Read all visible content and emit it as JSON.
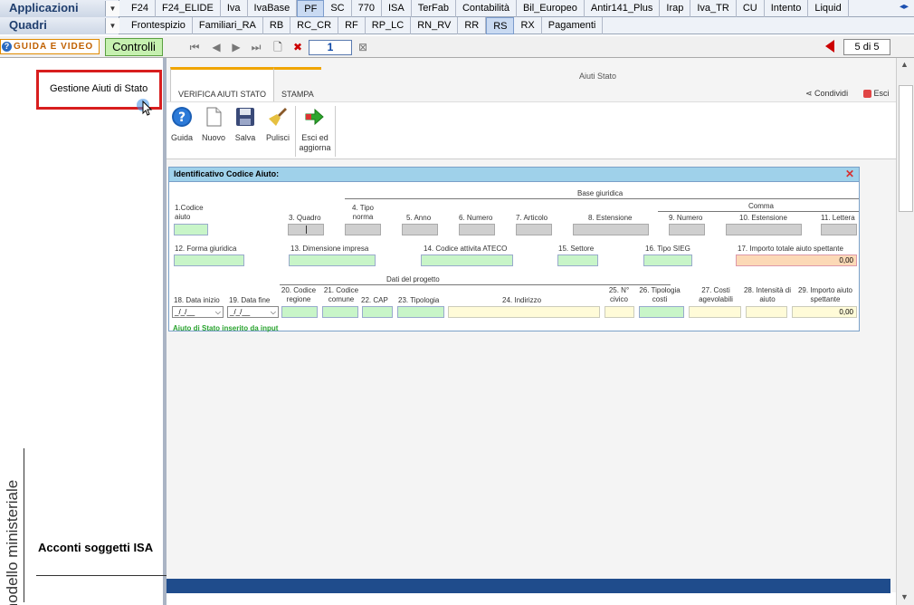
{
  "top_menu": {
    "row1_label": "Applicazioni",
    "row1_items": [
      "F24",
      "F24_ELIDE",
      "Iva",
      "IvaBase",
      "PF",
      "SC",
      "770",
      "ISA",
      "TerFab",
      "Contabilità",
      "Bil_Europeo",
      "Antir141_Plus",
      "Irap",
      "Iva_TR",
      "CU",
      "Intento",
      "Liquid"
    ],
    "row1_selected": "PF",
    "row2_label": "Quadri",
    "row2_items": [
      "Frontespizio",
      "Familiari_RA",
      "RB",
      "RC_CR",
      "RF",
      "RP_LC",
      "RN_RV",
      "RR",
      "RS",
      "RX",
      "Pagamenti"
    ],
    "row2_selected": "RS"
  },
  "toolbar": {
    "guida_label": "GUIDA E VIDEO",
    "controlli_label": "Controlli",
    "page_number": "1",
    "page_of": "5 di 5"
  },
  "left": {
    "vertical_text": "modello ministeriale",
    "acconti_label": "Acconti soggetti ISA",
    "gestione_label": "Gestione Aiuti di Stato"
  },
  "window": {
    "title": "Aiuti Stato",
    "tabs": [
      "VERIFICA AIUTI STATO",
      "STAMPA"
    ],
    "share_label": "Condividi",
    "exit_label": "Esci",
    "ribbon": [
      {
        "label": "Guida",
        "icon": "help-icon"
      },
      {
        "label": "Nuovo",
        "icon": "new-document-icon"
      },
      {
        "label": "Salva",
        "icon": "save-icon"
      },
      {
        "label": "Pulisci",
        "icon": "broom-icon"
      },
      {
        "label": "Esci ed aggiorna",
        "icon": "exit-arrow-icon"
      }
    ]
  },
  "dialog": {
    "title": "Identificativo Codice Aiuto:",
    "section_base": "Base giuridica",
    "section_comma": "Comma",
    "section_progetto": "Dati del progetto",
    "labels": {
      "f1": "1.Codice aiuto",
      "f3": "3. Quadro",
      "f4": "4. Tipo norma",
      "f5": "5. Anno",
      "f6": "6. Numero",
      "f7": "7. Articolo",
      "f8": "8. Estensione",
      "f9": "9. Numero",
      "f10": "10. Estensione",
      "f11": "11. Lettera",
      "f12": "12. Forma giuridica",
      "f13": "13. Dimensione impresa",
      "f14": "14. Codice attivita ATECO",
      "f15": "15. Settore",
      "f16": "16. Tipo SIEG",
      "f17": "17. Importo totale aiuto spettante",
      "f18": "18. Data inizio",
      "f19": "19. Data fine",
      "f20": "20. Codice regione",
      "f21": "21. Codice comune",
      "f22": "22. CAP",
      "f23": "23. Tipologia",
      "f24": "24. Indirizzo",
      "f25": "25. N° civico",
      "f26": "26. Tipologia costi",
      "f27": "27. Costi agevolabili",
      "f28": "28. Intensità di aiuto",
      "f29": "29. Importo aiuto spettante"
    },
    "values": {
      "importo_totale": "0,00",
      "data_inizio": "_/_/__",
      "data_fine": "_/_/__",
      "importo_aiuto": "0,00"
    },
    "status": "Aiuto di Stato inserito da input"
  }
}
